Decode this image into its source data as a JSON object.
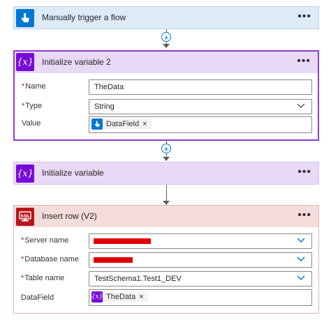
{
  "trigger": {
    "title": "Manually trigger a flow",
    "more": "•••",
    "icon": "touch-hand-icon",
    "color": "#0078d4"
  },
  "init2": {
    "title": "Initialize variable 2",
    "more": "•••",
    "icon": "variable-icon",
    "icon_glyph": "{x}",
    "color": "#770bd6",
    "fields": {
      "name": {
        "label": "Name",
        "value": "TheData",
        "required": "*"
      },
      "type": {
        "label": "Type",
        "value": "String",
        "required": "*"
      },
      "value": {
        "label": "Value",
        "token": "DataField",
        "token_remove": "×"
      }
    }
  },
  "init1": {
    "title": "Initialize variable",
    "more": "•••",
    "icon": "variable-icon",
    "icon_glyph": "{x}",
    "color": "#770bd6"
  },
  "insert": {
    "title": "Insert row (V2)",
    "more": "•••",
    "icon": "sql-server-icon",
    "icon_text": "SQL",
    "color": "#ba141a",
    "fields": {
      "server": {
        "label": "Server name",
        "required": "*"
      },
      "database": {
        "label": "Database name",
        "required": "*"
      },
      "table": {
        "label": "Table name",
        "value": "TestSchema1.Test1_DEV",
        "required": "*"
      },
      "datafield": {
        "label": "DataField",
        "token": "TheData",
        "token_remove": "×",
        "token_glyph": "{x}"
      }
    }
  },
  "connector": {
    "plus": "+"
  }
}
